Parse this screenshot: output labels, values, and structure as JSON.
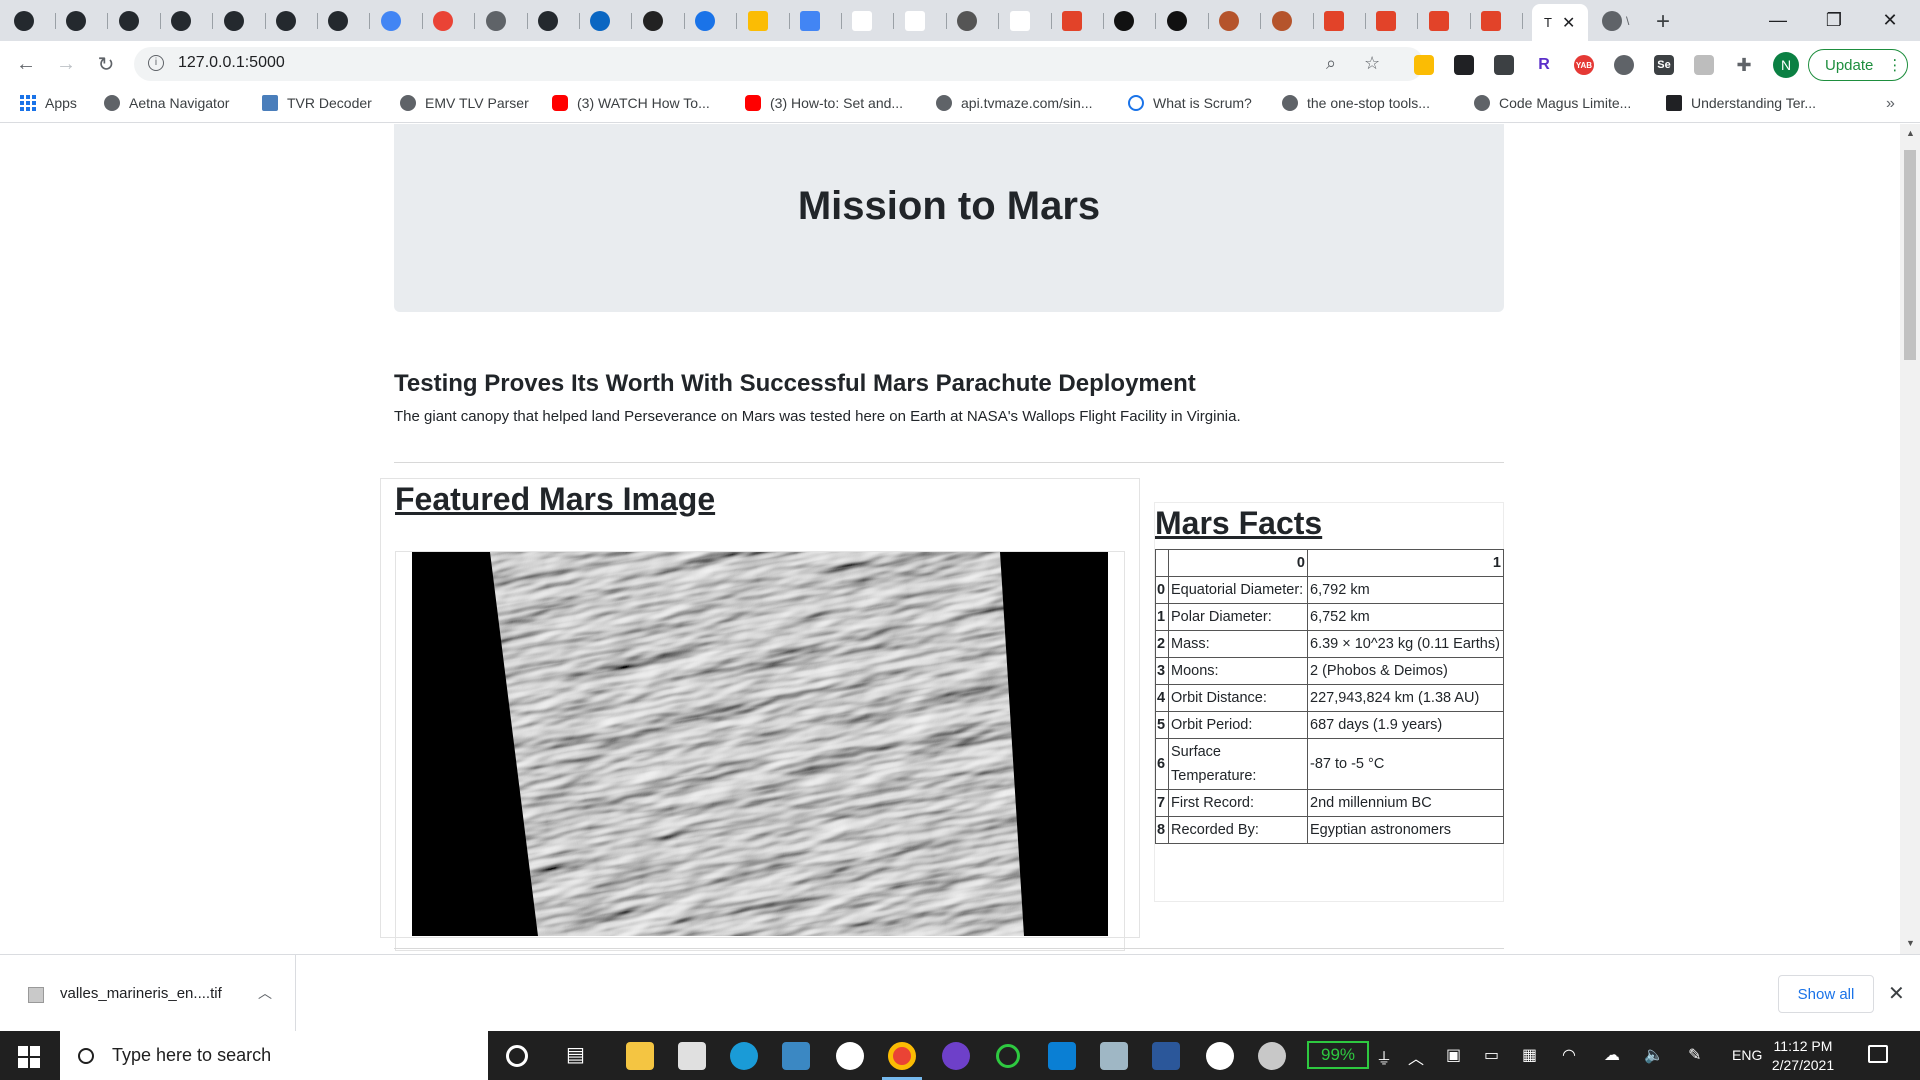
{
  "browser": {
    "tab_icons": [
      "github-icon",
      "github-icon",
      "github-icon",
      "github-icon",
      "github-icon",
      "github-icon",
      "github-icon",
      "translate-icon",
      "gmail-icon",
      "globe-icon",
      "github-icon",
      "linkedin-icon",
      "puzzle-icon",
      "zapier-icon",
      "drive-icon",
      "docs-icon",
      "cs-icon",
      "k-icon",
      "film-icon",
      "google-icon",
      "gitlab-icon",
      "zeplin-icon",
      "zeplin-icon",
      "mars-icon",
      "mars-icon",
      "gitlab-icon",
      "gitlab-icon",
      "gitlab-icon",
      "gitlab-icon"
    ],
    "active_tab_title": "T",
    "url": "127.0.0.1:5000",
    "update_label": "Update",
    "profile_initial": "N",
    "bookmarks": [
      {
        "label": "Apps",
        "icon": "apps-icon"
      },
      {
        "label": "Aetna Navigator",
        "icon": "globe-icon"
      },
      {
        "label": "TVR Decoder",
        "icon": "tvr-icon"
      },
      {
        "label": "EMV TLV Parser",
        "icon": "globe-icon"
      },
      {
        "label": "(3) WATCH How To...",
        "icon": "youtube-icon"
      },
      {
        "label": "(3) How-to: Set and...",
        "icon": "youtube-icon"
      },
      {
        "label": "api.tvmaze.com/sin...",
        "icon": "globe-icon"
      },
      {
        "label": "What is Scrum?",
        "icon": "scrum-icon"
      },
      {
        "label": "the one-stop tools...",
        "icon": "globe-icon"
      },
      {
        "label": "Code Magus Limite...",
        "icon": "globe-icon"
      },
      {
        "label": "Understanding Ter...",
        "icon": "doc-icon"
      }
    ]
  },
  "page": {
    "title": "Mission to Mars",
    "news_title": "Testing Proves Its Worth With Successful Mars Parachute Deployment",
    "news_paragraph": "The giant canopy that helped land Perseverance on Mars was tested here on Earth at NASA's Wallops Flight Facility in Virginia.",
    "featured_heading": "Featured Mars Image",
    "facts_heading": "Mars Facts",
    "facts_table": {
      "headers": [
        "",
        "0",
        "1"
      ],
      "rows": [
        {
          "index": "0",
          "label": "Equatorial Diameter:",
          "value": "6,792 km"
        },
        {
          "index": "1",
          "label": "Polar Diameter:",
          "value": "6,752 km"
        },
        {
          "index": "2",
          "label": "Mass:",
          "value": "6.39 × 10^23 kg (0.11 Earths)"
        },
        {
          "index": "3",
          "label": "Moons:",
          "value": "2 (Phobos & Deimos)"
        },
        {
          "index": "4",
          "label": "Orbit Distance:",
          "value": "227,943,824 km (1.38 AU)"
        },
        {
          "index": "5",
          "label": "Orbit Period:",
          "value": "687 days (1.9 years)"
        },
        {
          "index": "6",
          "label": "Surface Temperature:",
          "value": "-87 to -5 °C"
        },
        {
          "index": "7",
          "label": "First Record:",
          "value": "2nd millennium BC"
        },
        {
          "index": "8",
          "label": "Recorded By:",
          "value": "Egyptian astronomers"
        }
      ]
    }
  },
  "downloads": {
    "filename": "valles_marineris_en....tif",
    "show_all_label": "Show all"
  },
  "taskbar": {
    "search_placeholder": "Type here to search",
    "battery": "99%",
    "language": "ENG",
    "time": "11:12 PM",
    "date": "2/27/2021"
  },
  "colors": {
    "accent_green": "#1e8e3e",
    "link_blue": "#1a73e8",
    "jumbotron_bg": "#e9ecef",
    "battery_green": "#2ec940"
  }
}
